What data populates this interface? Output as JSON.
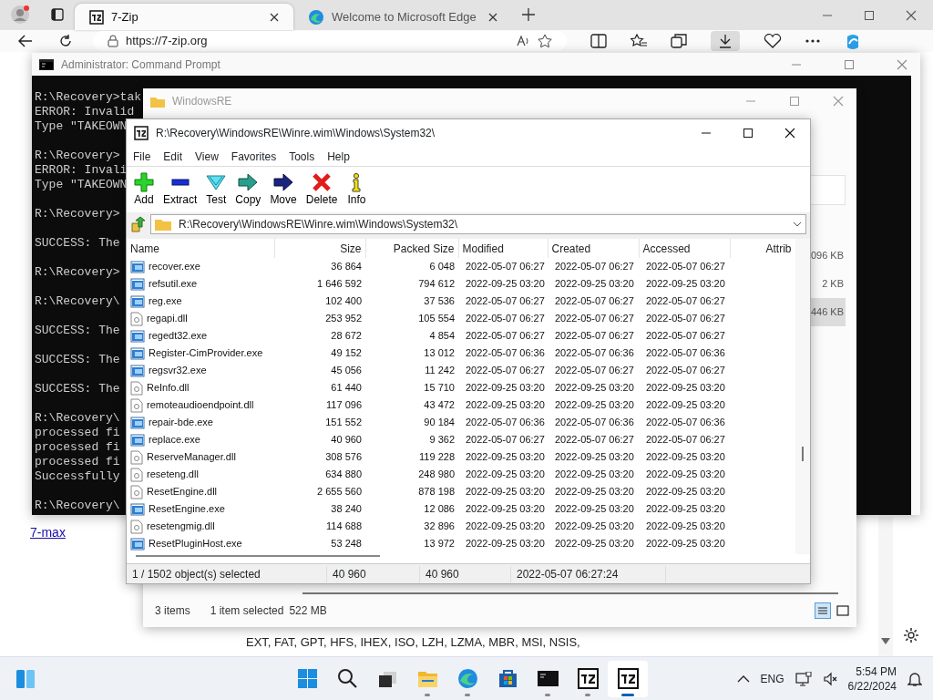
{
  "browser": {
    "tabs": [
      {
        "label": "7-Zip",
        "selected": true,
        "kind": "archive"
      },
      {
        "label": "Welcome to Microsoft Edge",
        "selected": false,
        "kind": "browser"
      }
    ],
    "address": "https://7-zip.org",
    "page": {
      "link": "7-max",
      "list_line": "EXT, FAT, GPT, HFS, IHEX, ISO, LZH, LZMA, MBR, MSI, NSIS,"
    }
  },
  "command_prompt": {
    "title": "Administrator: Command Prompt",
    "blocks": [
      [
        "R:\\Recovery>tak",
        "ERROR: Invalid",
        "Type \"TAKEOWN"
      ],
      [
        "R:\\Recovery>",
        "ERROR: Invali",
        "Type \"TAKEOWN"
      ],
      [
        "R:\\Recovery>"
      ],
      [
        "SUCCESS: The"
      ],
      [
        "R:\\Recovery>"
      ],
      [
        "R:\\Recovery\\"
      ],
      [
        "SUCCESS: The"
      ],
      [
        "SUCCESS: The"
      ],
      [
        "SUCCESS: The"
      ],
      [
        "R:\\Recovery\\",
        "processed fi",
        "processed fi",
        "processed fi",
        "Successfully"
      ],
      [
        "R:\\Recovery\\"
      ]
    ]
  },
  "explorer": {
    "title": "WindowsRE",
    "sizes": [
      {
        "text": "096 KB",
        "selected": false
      },
      {
        "text": "2 KB",
        "selected": false
      },
      {
        "text": "446 KB",
        "selected": true
      }
    ],
    "status": {
      "items": "3 items",
      "selection": "1 item selected",
      "size": "522 MB"
    },
    "views": [
      {
        "kind": "details",
        "selected": true
      },
      {
        "kind": "tiles",
        "selected": false
      }
    ]
  },
  "sevenzip": {
    "title": "R:\\Recovery\\WindowsRE\\Winre.wim\\Windows\\System32\\",
    "menu": [
      "File",
      "Edit",
      "View",
      "Favorites",
      "Tools",
      "Help"
    ],
    "toolbar": [
      {
        "label": "Add",
        "kind": "add"
      },
      {
        "label": "Extract",
        "kind": "extract"
      },
      {
        "label": "Test",
        "kind": "test"
      },
      {
        "label": "Copy",
        "kind": "copy"
      },
      {
        "label": "Move",
        "kind": "move"
      },
      {
        "label": "Delete",
        "kind": "delete"
      },
      {
        "label": "Info",
        "kind": "info"
      }
    ],
    "path": "R:\\Recovery\\WindowsRE\\Winre.wim\\Windows\\System32\\",
    "columns": [
      "Name",
      "Size",
      "Packed Size",
      "Modified",
      "Created",
      "Accessed",
      "Attrib"
    ],
    "rows": [
      {
        "kind": "exe",
        "name": "recover.exe",
        "size": "36 864",
        "packed": "6 048",
        "modified": "2022-05-07 06:27",
        "created": "2022-05-07 06:27",
        "accessed": "2022-05-07 06:27"
      },
      {
        "kind": "exe",
        "name": "refsutil.exe",
        "size": "1 646 592",
        "packed": "794 612",
        "modified": "2022-09-25 03:20",
        "created": "2022-09-25 03:20",
        "accessed": "2022-09-25 03:20"
      },
      {
        "kind": "exe",
        "name": "reg.exe",
        "size": "102 400",
        "packed": "37 536",
        "modified": "2022-05-07 06:27",
        "created": "2022-05-07 06:27",
        "accessed": "2022-05-07 06:27"
      },
      {
        "kind": "dll",
        "name": "regapi.dll",
        "size": "253 952",
        "packed": "105 554",
        "modified": "2022-05-07 06:27",
        "created": "2022-05-07 06:27",
        "accessed": "2022-05-07 06:27"
      },
      {
        "kind": "exe",
        "name": "regedt32.exe",
        "size": "28 672",
        "packed": "4 854",
        "modified": "2022-05-07 06:27",
        "created": "2022-05-07 06:27",
        "accessed": "2022-05-07 06:27"
      },
      {
        "kind": "exe",
        "name": "Register-CimProvider.exe",
        "size": "49 152",
        "packed": "13 012",
        "modified": "2022-05-07 06:36",
        "created": "2022-05-07 06:36",
        "accessed": "2022-05-07 06:36"
      },
      {
        "kind": "exe",
        "name": "regsvr32.exe",
        "size": "45 056",
        "packed": "11 242",
        "modified": "2022-05-07 06:27",
        "created": "2022-05-07 06:27",
        "accessed": "2022-05-07 06:27"
      },
      {
        "kind": "dll",
        "name": "ReInfo.dll",
        "size": "61 440",
        "packed": "15 710",
        "modified": "2022-09-25 03:20",
        "created": "2022-09-25 03:20",
        "accessed": "2022-09-25 03:20"
      },
      {
        "kind": "dll",
        "name": "remoteaudioendpoint.dll",
        "size": "117 096",
        "packed": "43 472",
        "modified": "2022-09-25 03:20",
        "created": "2022-09-25 03:20",
        "accessed": "2022-09-25 03:20"
      },
      {
        "kind": "exe",
        "name": "repair-bde.exe",
        "size": "151 552",
        "packed": "90 184",
        "modified": "2022-05-07 06:36",
        "created": "2022-05-07 06:36",
        "accessed": "2022-05-07 06:36"
      },
      {
        "kind": "exe",
        "name": "replace.exe",
        "size": "40 960",
        "packed": "9 362",
        "modified": "2022-05-07 06:27",
        "created": "2022-05-07 06:27",
        "accessed": "2022-05-07 06:27"
      },
      {
        "kind": "dll",
        "name": "ReserveManager.dll",
        "size": "308 576",
        "packed": "119 228",
        "modified": "2022-09-25 03:20",
        "created": "2022-09-25 03:20",
        "accessed": "2022-09-25 03:20"
      },
      {
        "kind": "dll",
        "name": "reseteng.dll",
        "size": "634 880",
        "packed": "248 980",
        "modified": "2022-09-25 03:20",
        "created": "2022-09-25 03:20",
        "accessed": "2022-09-25 03:20"
      },
      {
        "kind": "dll",
        "name": "ResetEngine.dll",
        "size": "2 655 560",
        "packed": "878 198",
        "modified": "2022-09-25 03:20",
        "created": "2022-09-25 03:20",
        "accessed": "2022-09-25 03:20"
      },
      {
        "kind": "exe",
        "name": "ResetEngine.exe",
        "size": "38 240",
        "packed": "12 086",
        "modified": "2022-09-25 03:20",
        "created": "2022-09-25 03:20",
        "accessed": "2022-09-25 03:20"
      },
      {
        "kind": "dll",
        "name": "resetengmig.dll",
        "size": "114 688",
        "packed": "32 896",
        "modified": "2022-09-25 03:20",
        "created": "2022-09-25 03:20",
        "accessed": "2022-09-25 03:20"
      },
      {
        "kind": "exe",
        "name": "ResetPluginHost.exe",
        "size": "53 248",
        "packed": "13 972",
        "modified": "2022-09-25 03:20",
        "created": "2022-09-25 03:20",
        "accessed": "2022-09-25 03:20"
      }
    ],
    "status": [
      "1 / 1502 object(s) selected",
      "40 960",
      "40 960",
      "2022-05-07 06:27:24"
    ]
  },
  "taskbar": {
    "apps": [
      {
        "kind": "start",
        "running": false,
        "selected": false
      },
      {
        "kind": "search",
        "running": false,
        "selected": false
      },
      {
        "kind": "taskview",
        "running": false,
        "selected": false
      },
      {
        "kind": "folder",
        "running": true,
        "selected": false
      },
      {
        "kind": "browser",
        "running": true,
        "selected": false
      },
      {
        "kind": "store",
        "running": false,
        "selected": false
      },
      {
        "kind": "terminal",
        "running": true,
        "selected": false
      },
      {
        "kind": "archive",
        "running": true,
        "selected": false
      },
      {
        "kind": "archive",
        "running": true,
        "selected": true
      }
    ],
    "language": "ENG",
    "time": "5:54 PM",
    "date": "6/22/2024"
  }
}
